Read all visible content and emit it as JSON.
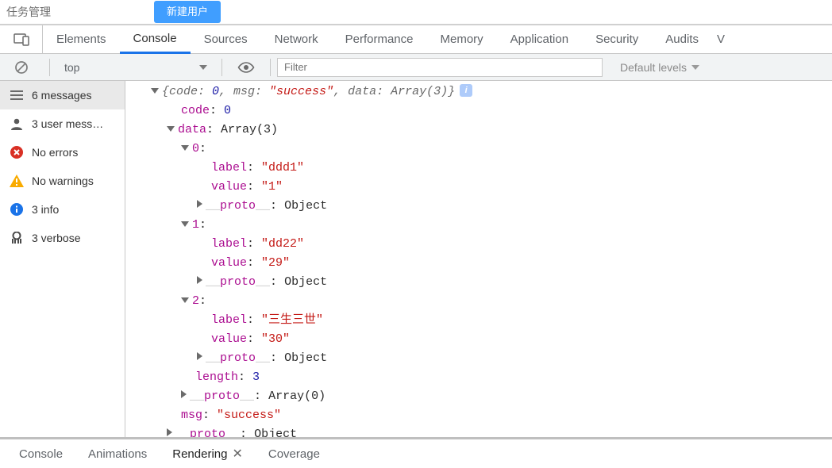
{
  "page": {
    "nav_fragment": "任务管理",
    "new_user_btn": "新建用户"
  },
  "tabs": {
    "elements": "Elements",
    "console": "Console",
    "sources": "Sources",
    "network": "Network",
    "performance": "Performance",
    "memory": "Memory",
    "application": "Application",
    "security": "Security",
    "audits": "Audits",
    "overflow": "V"
  },
  "toolbar": {
    "context": "top",
    "filter_placeholder": "Filter",
    "levels": "Default levels"
  },
  "sidebar": {
    "messages": "6 messages",
    "user_msgs": "3 user mess…",
    "no_errors": "No errors",
    "no_warnings": "No warnings",
    "info": "3 info",
    "verbose": "3 verbose"
  },
  "obj": {
    "summary_pre": "{code: ",
    "summary_code": "0",
    "summary_mid1": ", msg: ",
    "summary_msg": "\"success\"",
    "summary_mid2": ", data: ",
    "summary_data": "Array(3)",
    "summary_post": "}",
    "code_key": "code",
    "code_val": "0",
    "data_key": "data",
    "data_type": "Array(3)",
    "items": [
      {
        "idx": "0",
        "label_key": "label",
        "label_val": "\"ddd1\"",
        "value_key": "value",
        "value_val": "\"1\""
      },
      {
        "idx": "1",
        "label_key": "label",
        "label_val": "\"dd22\"",
        "value_key": "value",
        "value_val": "\"29\""
      },
      {
        "idx": "2",
        "label_key": "label",
        "label_val": "\"三生三世\"",
        "value_key": "value",
        "value_val": "\"30\""
      }
    ],
    "proto_key": "__proto__",
    "proto_obj": "Object",
    "length_key": "length",
    "length_val": "3",
    "arr_proto_type": "Array(0)",
    "msg_key": "msg",
    "msg_val": "\"success\"",
    "colon": ": "
  },
  "drawer": {
    "console": "Console",
    "animations": "Animations",
    "rendering": "Rendering",
    "coverage": "Coverage"
  }
}
